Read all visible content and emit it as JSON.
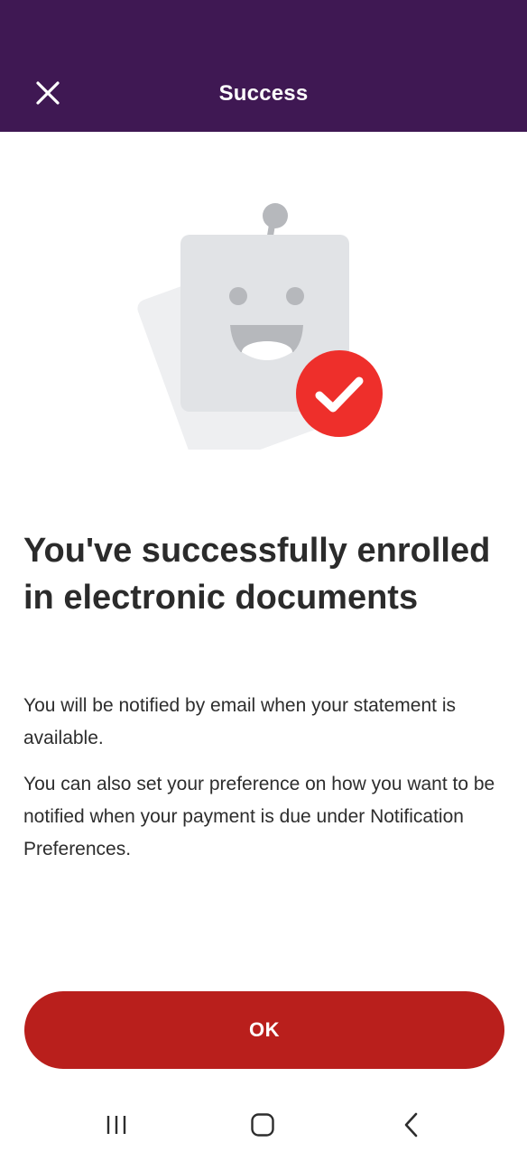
{
  "header": {
    "title": "Success",
    "close_icon": "close-icon",
    "background": "#3f1853"
  },
  "illustration": {
    "icon": "robot-success-icon",
    "badge_icon": "checkmark-icon",
    "badge_color": "#ee2f2b"
  },
  "content": {
    "headline": "You've successfully enrolled in electronic documents",
    "paragraph_1": "You will be notified by email when your statement is available.",
    "paragraph_2": "You can also set your preference on how you want to be notified when your payment is due under Notification Preferences."
  },
  "actions": {
    "ok_label": "OK",
    "ok_color": "#b91f1c"
  },
  "system_nav": {
    "recents_icon": "recents-icon",
    "home_icon": "home-icon",
    "back_icon": "back-icon"
  }
}
